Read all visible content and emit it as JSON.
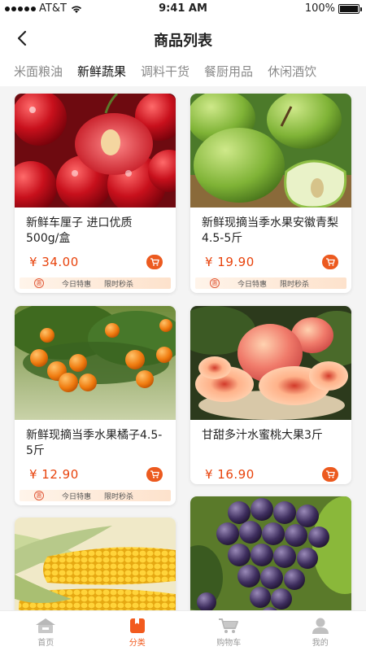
{
  "status": {
    "carrier": "AT&T",
    "time": "9:41 AM",
    "battery": "100%"
  },
  "header": {
    "title": "商品列表"
  },
  "tabs": [
    {
      "label": "米面粮油"
    },
    {
      "label": "新鲜蔬果",
      "active": true
    },
    {
      "label": "调料干货"
    },
    {
      "label": "餐厨用品"
    },
    {
      "label": "休闲酒饮"
    }
  ],
  "products": [
    {
      "name": "新鲜车厘子 进口优质500g/盒",
      "price": "¥ 34.00",
      "image": "cherries",
      "promo": [
        "今日特惠",
        "限时秒杀"
      ],
      "seal": "惠"
    },
    {
      "name": "新鲜现摘当季水果安徽青梨4.5-5斤",
      "price": "¥ 19.90",
      "image": "green-pears",
      "promo": [
        "今日特惠",
        "限时秒杀"
      ],
      "seal": "惠"
    },
    {
      "name": "新鲜现摘当季水果橘子4.5-5斤",
      "price": "¥ 12.90",
      "image": "orange-tree",
      "promo": [
        "今日特惠",
        "限时秒杀"
      ],
      "seal": "惠"
    },
    {
      "name": "甘甜多汁水蜜桃大果3斤",
      "price": "¥ 16.90",
      "image": "peaches",
      "promo": [],
      "seal": ""
    },
    {
      "name": "",
      "price": "",
      "image": "corn",
      "promo": [],
      "seal": ""
    },
    {
      "name": "",
      "price": "",
      "image": "grapes",
      "promo": [],
      "seal": ""
    }
  ],
  "bottom_nav": [
    {
      "label": "首页",
      "icon": "home-icon"
    },
    {
      "label": "分类",
      "icon": "category-icon",
      "active": true
    },
    {
      "label": "购物车",
      "icon": "cart-icon"
    },
    {
      "label": "我的",
      "icon": "user-icon"
    }
  ],
  "colors": {
    "accent": "#f25a1e",
    "price": "#e8430c",
    "background": "#f4f4f4"
  }
}
